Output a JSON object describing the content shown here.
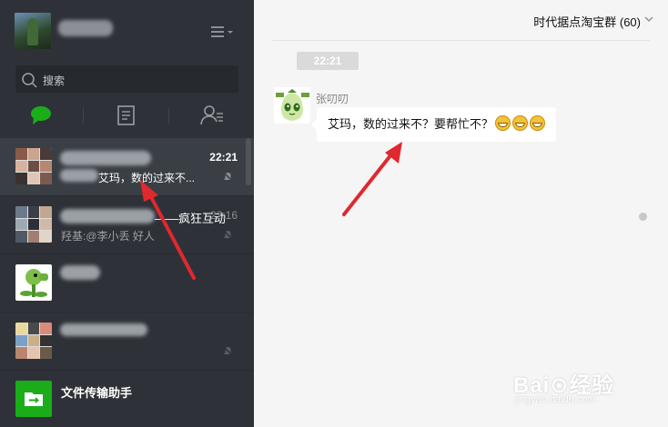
{
  "sidebar": {
    "search_placeholder": "搜索",
    "chats": [
      {
        "name": "",
        "time": "22:21",
        "preview": "艾玛，数的过来不...",
        "muted": true,
        "active": true
      },
      {
        "name": "——疯狂互动",
        "time": "22:16",
        "preview": "羟基:@李小丢 好人",
        "muted": true,
        "active": false
      },
      {
        "name": "",
        "time": "",
        "preview": "",
        "muted": false,
        "active": false
      },
      {
        "name": "",
        "time": "",
        "preview": "",
        "muted": true,
        "active": false
      },
      {
        "name": "文件传输助手",
        "time": "",
        "preview": "",
        "muted": false,
        "active": false
      }
    ]
  },
  "chat": {
    "title": "时代据点淘宝群 (60)",
    "time_divider": "22:21",
    "message": {
      "sender": "张叨叨",
      "text": "艾玛，数的过来不？要帮忙不？"
    }
  },
  "watermark": {
    "main": "Bai⊙经验",
    "sub": "jingyan.baidu.com"
  },
  "colors": {
    "sidebar_bg": "#2e3238",
    "main_bg": "#f5f5f5",
    "accent_green": "#1aad19",
    "arrow_red": "#e0282e"
  }
}
